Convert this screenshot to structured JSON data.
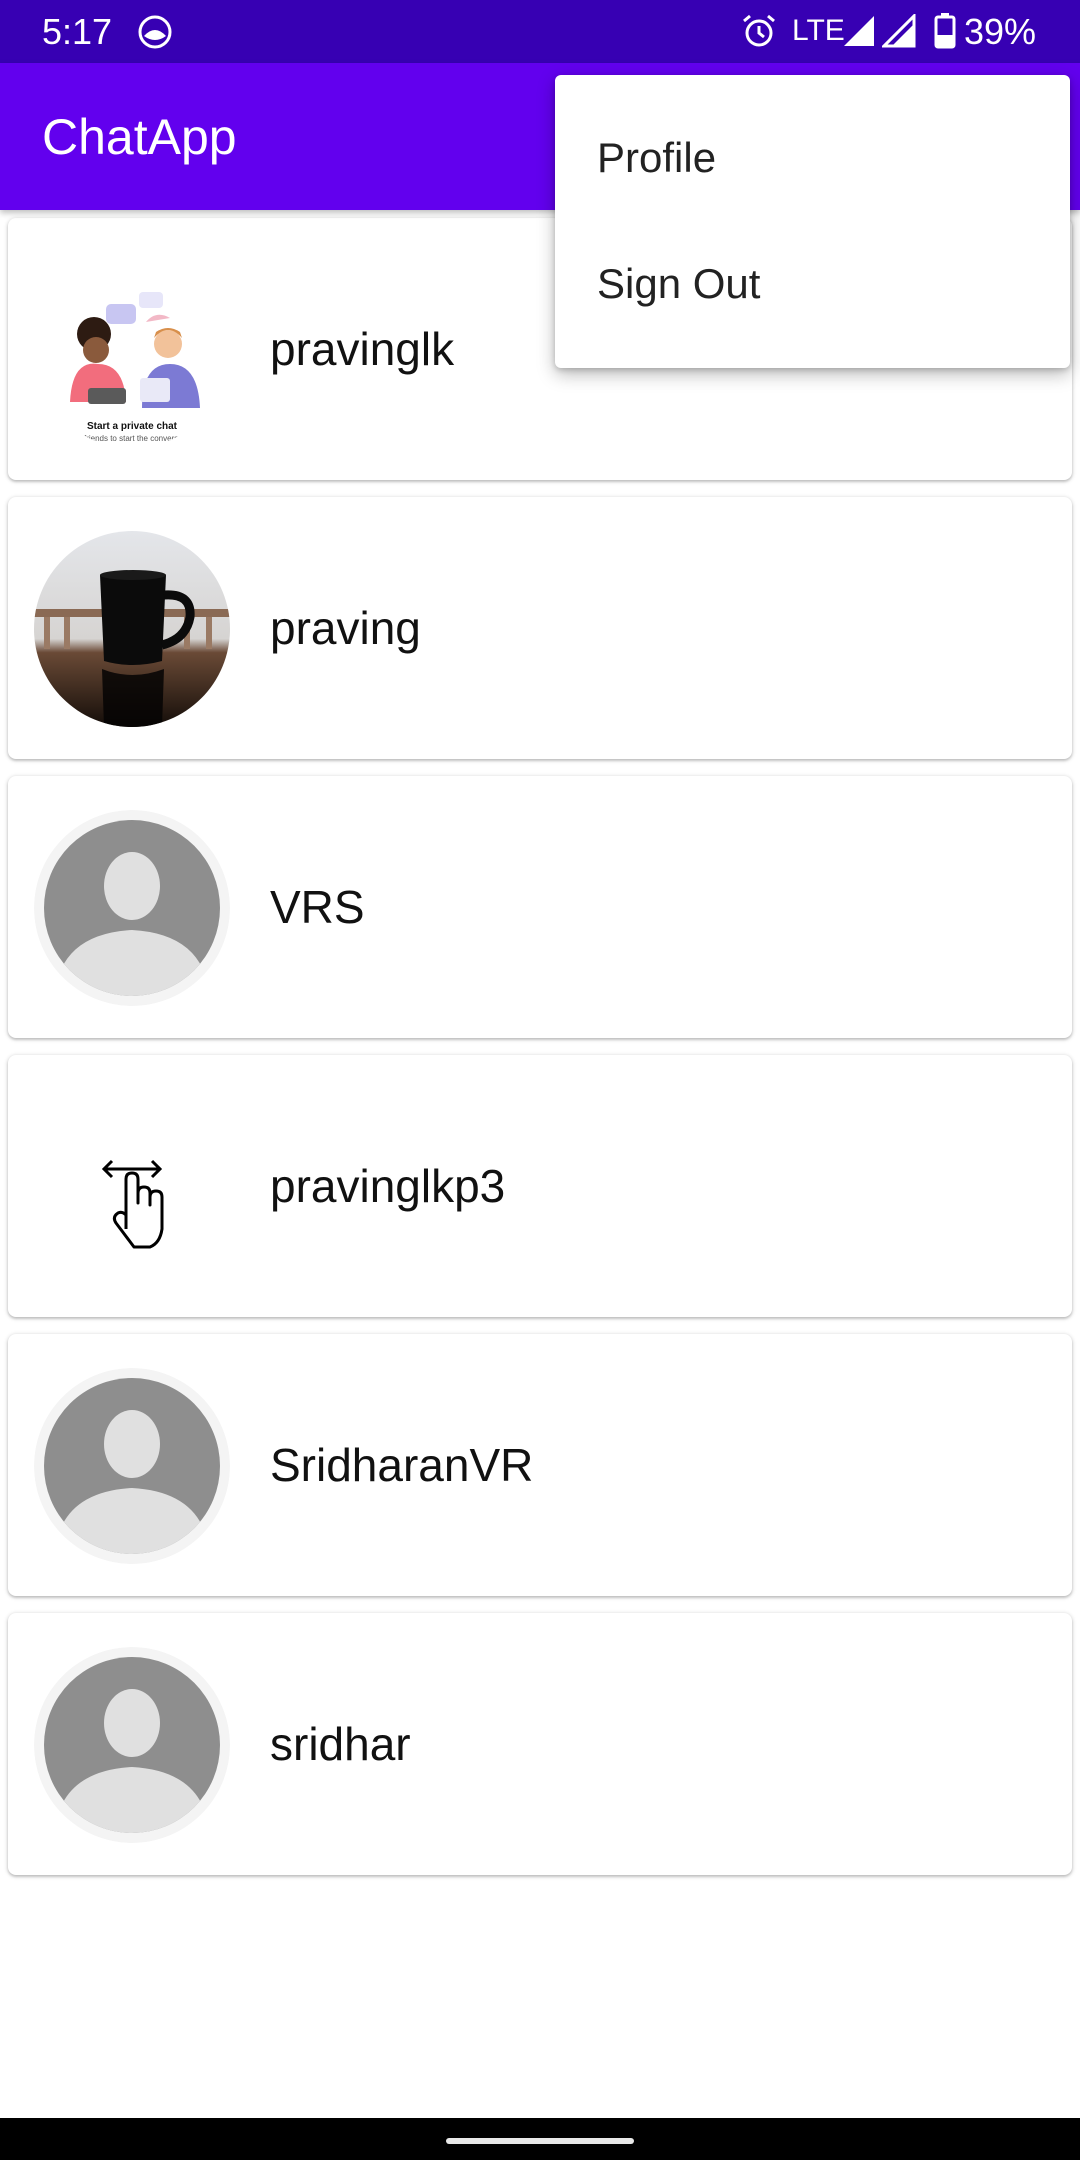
{
  "status_bar": {
    "time": "5:17",
    "network": "LTE",
    "battery": "39%",
    "icons": [
      "app-notification-icon",
      "alarm-icon",
      "signal-icon",
      "signal-icon",
      "battery-icon"
    ]
  },
  "app_bar": {
    "title": "ChatApp"
  },
  "menu": {
    "items": [
      {
        "label": "Profile"
      },
      {
        "label": "Sign Out"
      }
    ]
  },
  "users": [
    {
      "name": "pravinglk",
      "avatar": "private-chat-illustration",
      "illustration_caption": "Start a private chat",
      "illustration_subcaption": "Ask friends to start the conversation"
    },
    {
      "name": "praving",
      "avatar": "coffee-mug-photo"
    },
    {
      "name": "VRS",
      "avatar": "default-person-icon"
    },
    {
      "name": "pravinglkp3",
      "avatar": "swipe-gesture-icon"
    },
    {
      "name": "SridharanVR",
      "avatar": "default-person-icon"
    },
    {
      "name": "sridhar",
      "avatar": "default-person-icon"
    }
  ],
  "colors": {
    "status_bar": "#3700b3",
    "app_bar": "#6200ee",
    "background": "#ffffff"
  }
}
